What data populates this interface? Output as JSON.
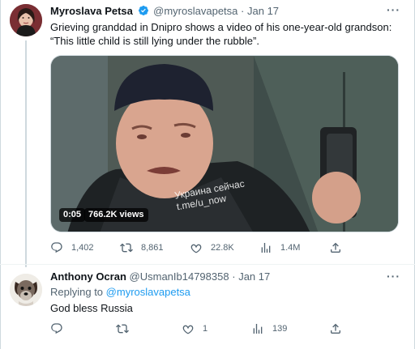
{
  "colors": {
    "accent": "#1d9bf0",
    "muted": "#536471",
    "text": "#0f1419"
  },
  "tweet1": {
    "name": "Myroslava Petsa",
    "handle": "@myroslavapetsa",
    "separator": "·",
    "date": "Jan 17",
    "verified_icon": "verified-badge-icon",
    "more_icon": "more-dots-icon",
    "text": "Grieving granddad in Dnipro shows a video of his one-year-old grandson: “This little child is still lying under the rubble”.",
    "media": {
      "duration": "0:05",
      "views": "766.2K views",
      "watermark_line1": "Украина сейчас",
      "watermark_line2": "t.me/u_now"
    },
    "actions": {
      "reply_count": "1,402",
      "retweet_count": "8,861",
      "like_count": "22.8K",
      "view_count": "1.4M"
    }
  },
  "tweet2": {
    "name": "Anthony Ocran",
    "handle": "@UsmanIb14798358",
    "separator": "·",
    "date": "Jan 17",
    "more_icon": "more-dots-icon",
    "replying_prefix": "Replying to",
    "replying_to": "@myroslavapetsa",
    "text": "God bless Russia",
    "actions": {
      "reply_count": "",
      "retweet_count": "",
      "like_count": "1",
      "view_count": "139"
    }
  }
}
